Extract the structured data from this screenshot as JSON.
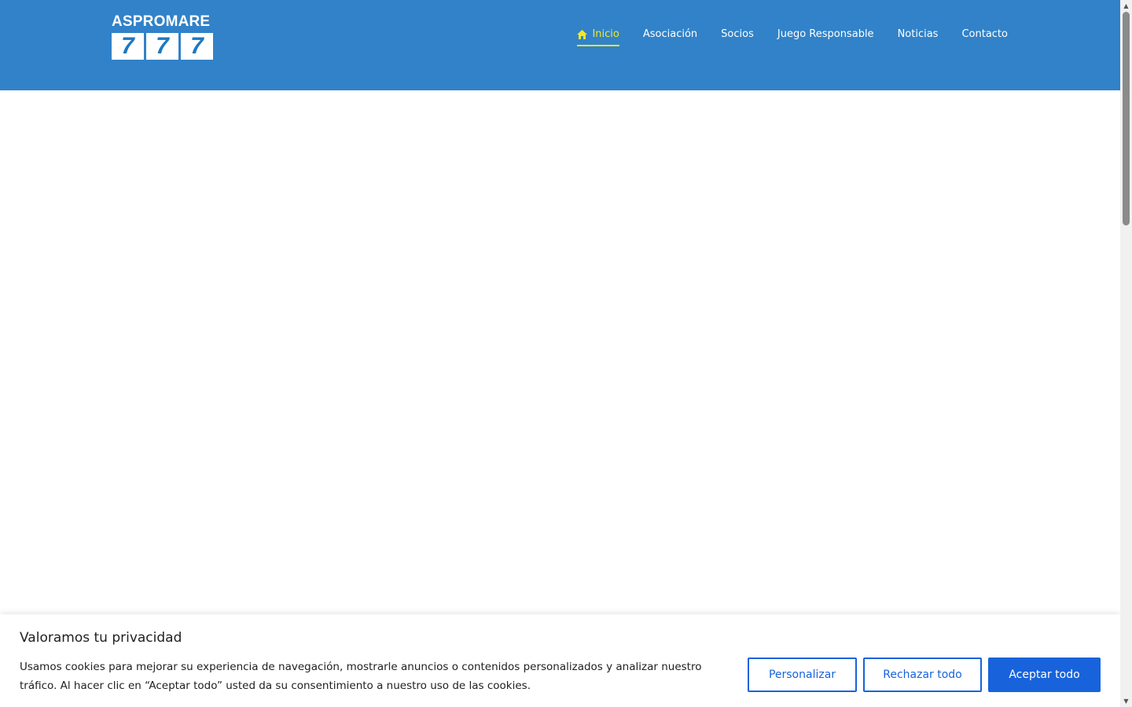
{
  "header": {
    "logo": {
      "text": "ASPROMARE",
      "digits": [
        "7",
        "7",
        "7"
      ]
    },
    "nav": [
      {
        "label": "Inicio",
        "icon": "home-icon",
        "active": true
      },
      {
        "label": "Asociación"
      },
      {
        "label": "Socios"
      },
      {
        "label": "Juego Responsable"
      },
      {
        "label": "Noticias"
      },
      {
        "label": "Contacto"
      }
    ]
  },
  "cookie_banner": {
    "title": "Valoramos tu privacidad",
    "text": "Usamos cookies para mejorar su experiencia de navegación, mostrarle anuncios o contenidos personalizados y analizar nuestro tráfico. Al hacer clic en “Aceptar todo” usted da su consentimiento a nuestro uso de las cookies.",
    "buttons": {
      "customize": "Personalizar",
      "reject": "Rechazar todo",
      "accept": "Aceptar todo"
    }
  },
  "colors": {
    "header_bg": "#3182c8",
    "active_nav": "#f3e52b",
    "button_blue": "#1863dc"
  }
}
